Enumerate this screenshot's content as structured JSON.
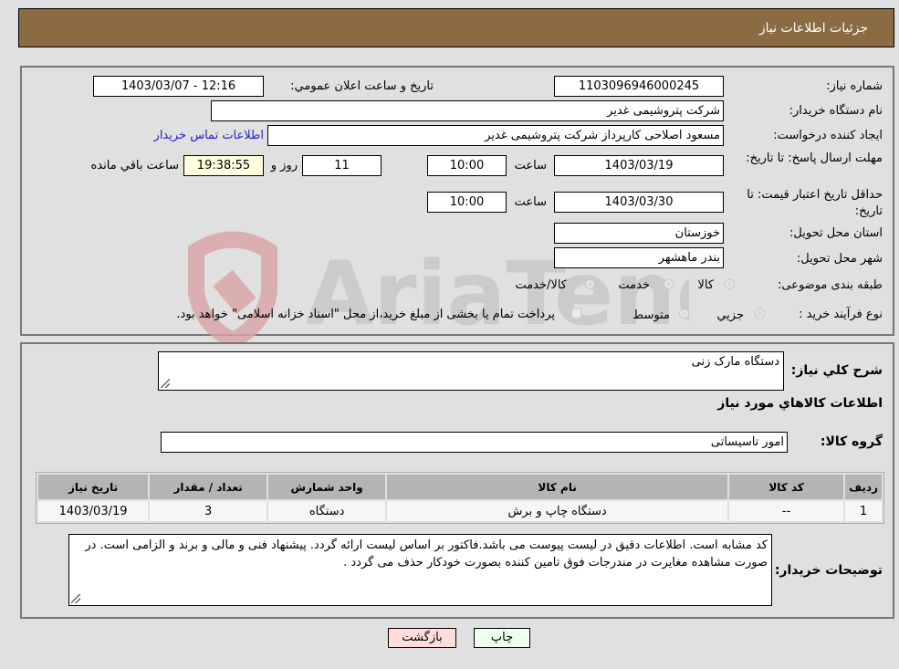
{
  "header": {
    "title": "جزئیات اطلاعات نیاز"
  },
  "details": {
    "need_number_label": "شماره نیاز:",
    "need_number": "1103096946000245",
    "announce_label": "تاریخ و ساعت اعلان عمومي:",
    "announce_value": "1403/03/07 - 12:16",
    "buyer_org_label": "نام دستگاه خریدار:",
    "buyer_org": "شرکت پتروشیمی غدیر",
    "creator_label": "ایجاد کننده درخواست:",
    "creator": "مسعود اصلاحی کارپرداز شرکت پتروشیمی غدیر",
    "contact_link": "اطلاعات تماس خریدار",
    "reply_deadline_label": "مهلت ارسال پاسخ: تا تاریخ:",
    "reply_date": "1403/03/19",
    "time_label": "ساعت",
    "reply_time": "10:00",
    "days_remaining": "11",
    "days_label": "روز و",
    "time_remaining": "19:38:55",
    "time_remaining_label": "ساعت باقي مانده",
    "price_validity_label": "حداقل تاریخ اعتبار قیمت: تا تاریخ:",
    "price_validity_date": "1403/03/30",
    "price_validity_time": "10:00",
    "province_label": "استان محل تحویل:",
    "province": "خوزستان",
    "city_label": "شهر محل تحویل:",
    "city": "بندر ماهشهر",
    "category_label": "طبقه بندی موضوعی:",
    "category_options": [
      "کالا",
      "خدمت",
      "کالا/خدمت"
    ],
    "process_label": "نوع فرآیند خرید :",
    "process_options": [
      "جزیي",
      "متوسط"
    ],
    "payment_note": "پرداخت تمام یا بخشی از مبلغ خرید،از محل \"اسناد خزانه اسلامی\" خواهد بود."
  },
  "goods": {
    "summary_label": "شرح كلي نياز:",
    "summary": "دستگاه مارک زنی",
    "section_title": "اطلاعات كالاهاي مورد نياز",
    "group_label": "گروه کالا:",
    "group": "امور تاسیساتی",
    "table": {
      "headers": [
        "ردیف",
        "کد کالا",
        "نام کالا",
        "واحد شمارش",
        "تعداد / مقدار",
        "تاریخ نیاز"
      ],
      "rows": [
        [
          "1",
          "--",
          "دستگاه چاپ و برش",
          "دستگاه",
          "3",
          "1403/03/19"
        ]
      ]
    },
    "buyer_notes_label": "توضیحات خریدار:",
    "buyer_notes": "کد مشابه است. اطلاعات دقیق در لیست پیوست می باشد.فاکتور بر اساس لیست ارائه گردد. پیشنهاد فنی و مالی و  برند و  الزامی است. در صورت مشاهده مغایرت در مندرجات فوق تامین کننده بصورت خودکار حذف می گردد ."
  },
  "buttons": {
    "print": "چاپ",
    "back": "بازگشت"
  },
  "watermark": {
    "text": "AriaTender.neT"
  },
  "colors": {
    "header_bg": "#8b6b42",
    "print_bg": "#eeffee",
    "back_bg": "#ffdddd",
    "link": "#2222cc"
  }
}
